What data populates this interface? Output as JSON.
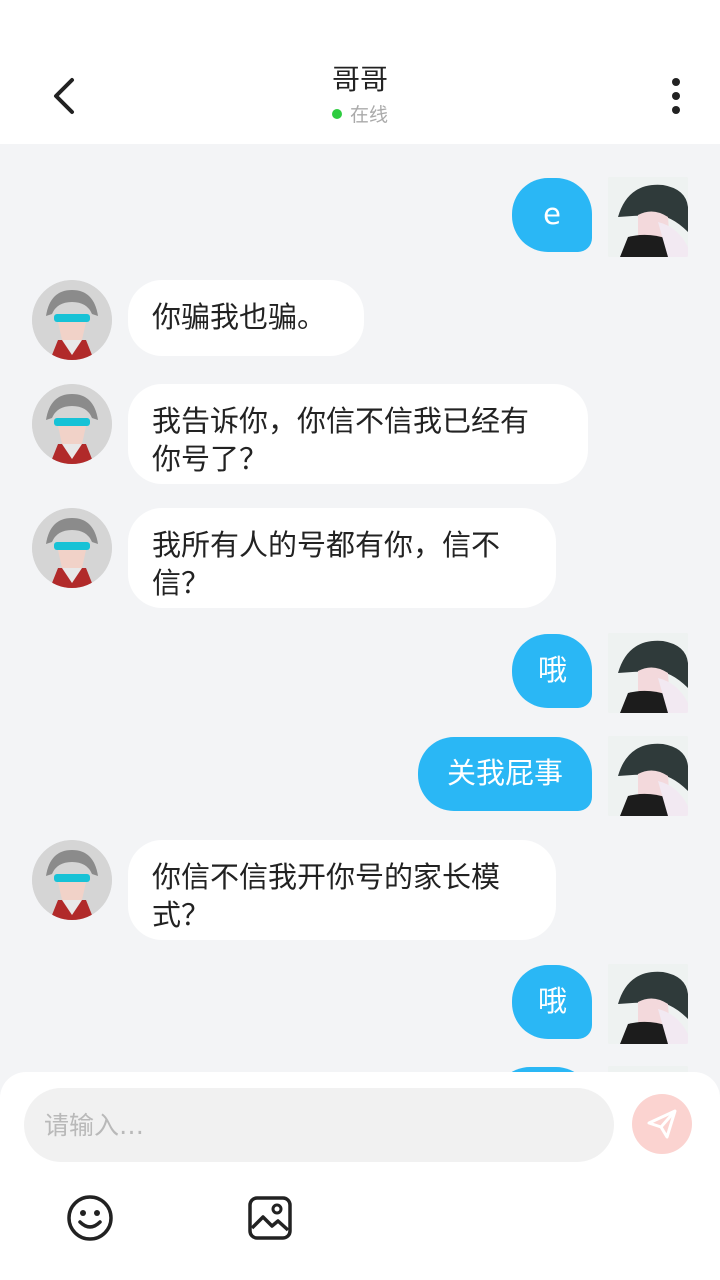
{
  "header": {
    "title": "哥哥",
    "status_text": "在线",
    "status_color": "#2ecc40",
    "back_icon": "chevron-left-icon",
    "more_icon": "more-vertical-icon"
  },
  "messages": [
    {
      "side": "right",
      "text": "e"
    },
    {
      "side": "left",
      "text": "你骗我也骗。"
    },
    {
      "side": "left",
      "text_lines": [
        "我告诉你，你信不信我已经有",
        "你号了？"
      ]
    },
    {
      "side": "left",
      "text_lines": [
        "我所有人的号都有你，信不",
        "信？"
      ]
    },
    {
      "side": "right",
      "text": "哦"
    },
    {
      "side": "right",
      "text": "关我屁事"
    },
    {
      "side": "left",
      "text_lines": [
        "你信不信我开你号的家长模",
        "式？"
      ]
    },
    {
      "side": "right",
      "text": "哦"
    }
  ],
  "composer": {
    "placeholder": "请输入…",
    "send_icon": "send-icon",
    "emoji_icon": "emoji-icon",
    "image_icon": "image-icon"
  },
  "colors": {
    "accent": "#2ab7f5",
    "background": "#f3f4f6",
    "send_disabled": "#fbd3d0"
  }
}
